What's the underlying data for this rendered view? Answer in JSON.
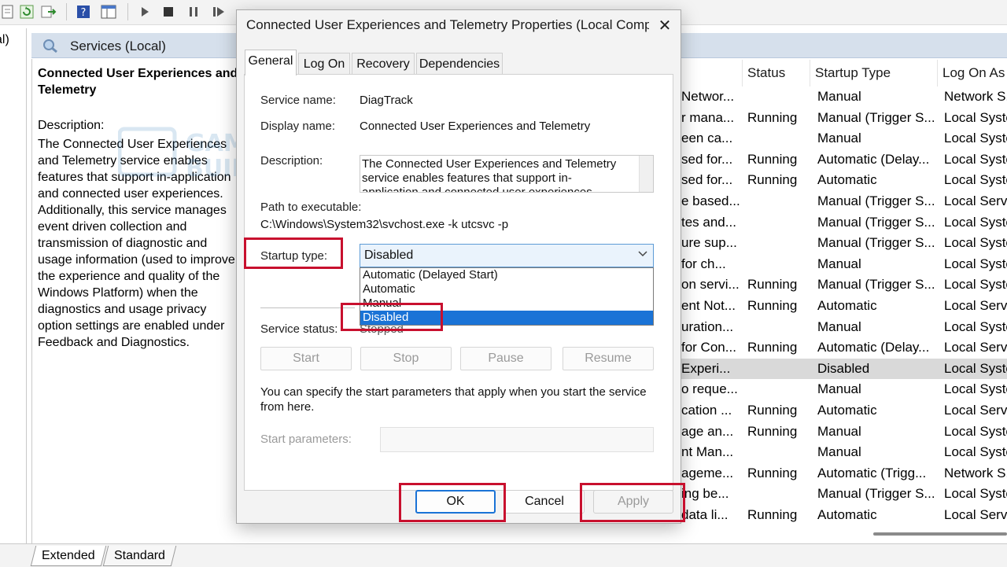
{
  "tree_label": "al)",
  "services_header": {
    "title": "Services (Local)"
  },
  "detail": {
    "title": "Connected User Experiences and Telemetry",
    "description_label": "Description:",
    "description": "The Connected User Experiences and Telemetry service enables features that support in-application and connected user experiences. Additionally, this service manages event driven collection and transmission of diagnostic and usage information (used to improve the experience and quality of the Windows Platform) when the diagnostics and usage privacy option settings are enabled under Feedback and Diagnostics."
  },
  "table": {
    "headers": {
      "status": "Status",
      "startup": "Startup Type",
      "logon": "Log On As"
    },
    "rows": [
      {
        "name": "Networ...",
        "status": "",
        "startup": "Manual",
        "logon": "Network S..."
      },
      {
        "name": "r mana...",
        "status": "Running",
        "startup": "Manual (Trigger S...",
        "logon": "Local Syste"
      },
      {
        "name": "een ca...",
        "status": "",
        "startup": "Manual",
        "logon": "Local Syste"
      },
      {
        "name": "sed for...",
        "status": "Running",
        "startup": "Automatic (Delay...",
        "logon": "Local Syste"
      },
      {
        "name": "sed for...",
        "status": "Running",
        "startup": "Automatic",
        "logon": "Local Syste"
      },
      {
        "name": "e based...",
        "status": "",
        "startup": "Manual (Trigger S...",
        "logon": "Local Servi"
      },
      {
        "name": "tes and...",
        "status": "",
        "startup": "Manual (Trigger S...",
        "logon": "Local Syste"
      },
      {
        "name": "ure sup...",
        "status": "",
        "startup": "Manual (Trigger S...",
        "logon": "Local Syste"
      },
      {
        "name": "for ch...",
        "status": "",
        "startup": "Manual",
        "logon": "Local Syste"
      },
      {
        "name": "on servi...",
        "status": "Running",
        "startup": "Manual (Trigger S...",
        "logon": "Local Syste"
      },
      {
        "name": "ent Not...",
        "status": "Running",
        "startup": "Automatic",
        "logon": "Local Servi"
      },
      {
        "name": "uration...",
        "status": "",
        "startup": "Manual",
        "logon": "Local Syste"
      },
      {
        "name": "for Con...",
        "status": "Running",
        "startup": "Automatic (Delay...",
        "logon": "Local Servi"
      },
      {
        "name": "Experi...",
        "status": "",
        "startup": "Disabled",
        "logon": "Local Syste",
        "selected": true
      },
      {
        "name": "o reque...",
        "status": "",
        "startup": "Manual",
        "logon": "Local Syste"
      },
      {
        "name": "cation ...",
        "status": "Running",
        "startup": "Automatic",
        "logon": "Local Servi"
      },
      {
        "name": "age an...",
        "status": "Running",
        "startup": "Manual",
        "logon": "Local Syste"
      },
      {
        "name": "nt Man...",
        "status": "",
        "startup": "Manual",
        "logon": "Local Syste"
      },
      {
        "name": "ageme...",
        "status": "Running",
        "startup": "Automatic (Trigg...",
        "logon": "Network S..."
      },
      {
        "name": "ing be...",
        "status": "",
        "startup": "Manual (Trigger S...",
        "logon": "Local Syste"
      },
      {
        "name": "data li...",
        "status": "Running",
        "startup": "Automatic",
        "logon": "Local Servi"
      }
    ]
  },
  "bottom_tabs": {
    "extended": "Extended",
    "standard": "Standard"
  },
  "dialog": {
    "title": "Connected User Experiences and Telemetry Properties (Local Comp...",
    "close": "✕",
    "tabs": {
      "general": "General",
      "logon": "Log On",
      "recovery": "Recovery",
      "dependencies": "Dependencies"
    },
    "service_name_label": "Service name:",
    "service_name": "DiagTrack",
    "display_name_label": "Display name:",
    "display_name": "Connected User Experiences and Telemetry",
    "description_label": "Description:",
    "description": "The Connected User Experiences and Telemetry service enables features that support in-application and connected user experiences. Additionally, this",
    "path_label": "Path to executable:",
    "path": "C:\\Windows\\System32\\svchost.exe -k utcsvc -p",
    "startup_type_label": "Startup type:",
    "startup_type_value": "Disabled",
    "startup_options": [
      "Automatic (Delayed Start)",
      "Automatic",
      "Manual",
      "Disabled"
    ],
    "service_status_label": "Service status:",
    "service_status": "Stopped",
    "buttons": {
      "start": "Start",
      "stop": "Stop",
      "pause": "Pause",
      "resume": "Resume"
    },
    "note": "You can specify the start parameters that apply when you start the service from here.",
    "start_params_label": "Start parameters:",
    "footer": {
      "ok": "OK",
      "cancel": "Cancel",
      "apply": "Apply"
    }
  },
  "watermark": {
    "line1": "GAMINGPC",
    "line2": "BUILDER"
  },
  "colors": {
    "highlight": "#c8102e",
    "selection": "#1a73d6",
    "header_bg": "#d6e0ec"
  }
}
